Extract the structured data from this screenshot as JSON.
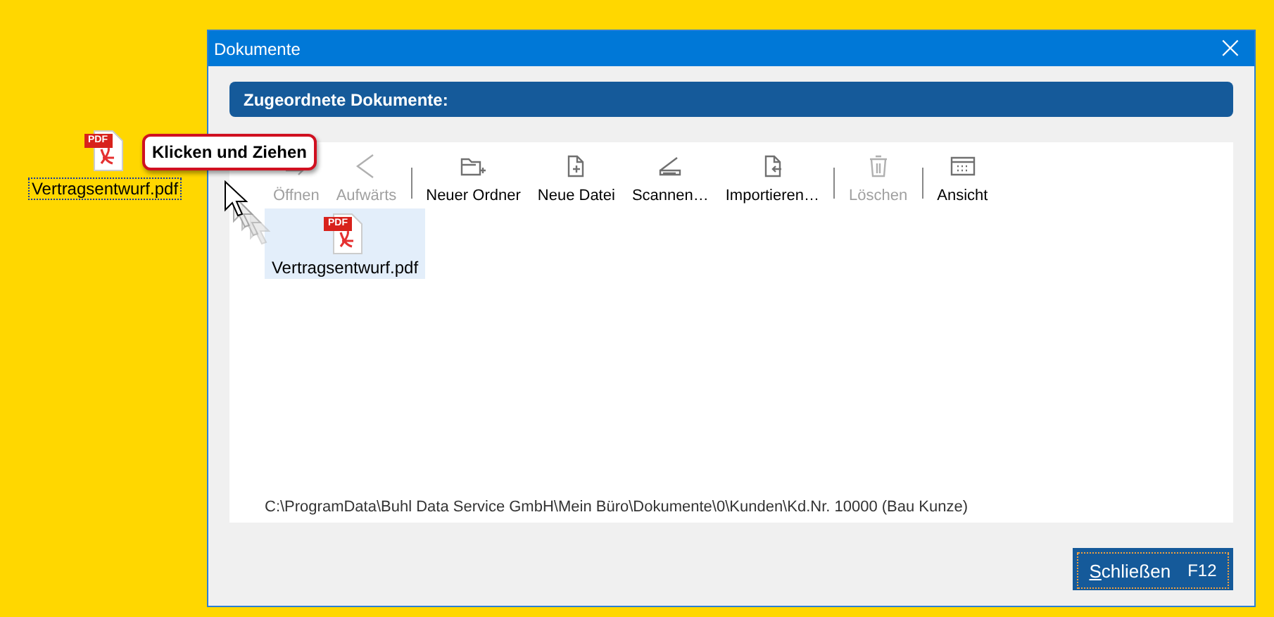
{
  "desktop_icon": {
    "label": "Vertragsentwurf.pdf",
    "badge": "PDF",
    "selected": true
  },
  "tooltip": {
    "text": "Klicken und Ziehen"
  },
  "window": {
    "title": "Dokumente",
    "close": "×"
  },
  "header": {
    "title": "Zugeordnete Dokumente:"
  },
  "toolbar": [
    {
      "kind": "open",
      "label": "Öffnen",
      "disabled": true
    },
    {
      "kind": "up",
      "label": "Aufwärts",
      "disabled": true
    },
    {
      "kind": "separator"
    },
    {
      "kind": "folder",
      "label": "Neuer Ordner",
      "disabled": false
    },
    {
      "kind": "file",
      "label": "Neue Datei",
      "disabled": false
    },
    {
      "kind": "scan",
      "label": "Scannen…",
      "disabled": false
    },
    {
      "kind": "import",
      "label": "Importieren…",
      "disabled": false
    },
    {
      "kind": "separator"
    },
    {
      "kind": "delete",
      "label": "Löschen",
      "disabled": true
    },
    {
      "kind": "separator"
    },
    {
      "kind": "view",
      "label": "Ansicht",
      "disabled": false
    }
  ],
  "files": [
    {
      "name": "Vertragsentwurf.pdf",
      "badge": "PDF",
      "selected": true
    }
  ],
  "path": "C:\\ProgramData\\Buhl Data Service GmbH\\Mein Büro\\Dokumente\\0\\Kunden\\Kd.Nr. 10000 (Bau Kunze)",
  "close_button": {
    "mnemonic": "S",
    "label": "chließen",
    "shortcut": "F12"
  }
}
